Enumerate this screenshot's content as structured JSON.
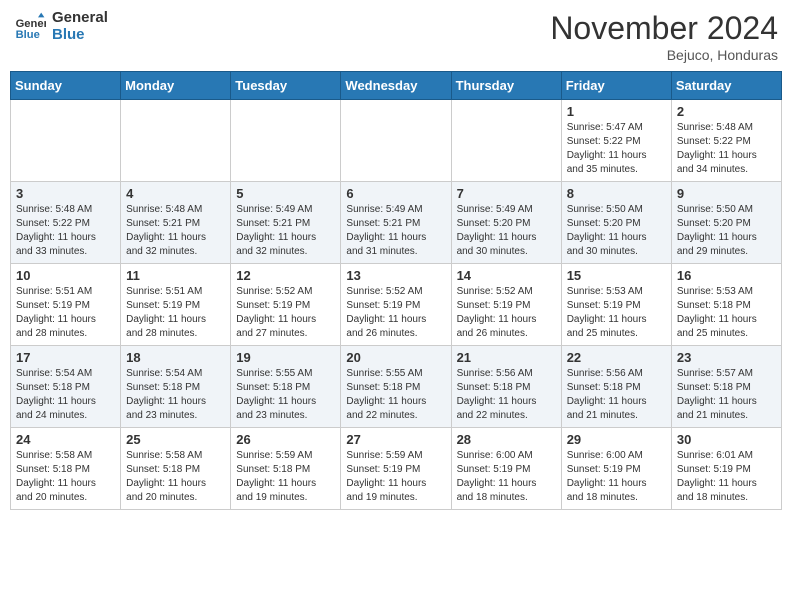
{
  "header": {
    "logo_line1": "General",
    "logo_line2": "Blue",
    "month_title": "November 2024",
    "location": "Bejuco, Honduras"
  },
  "weekdays": [
    "Sunday",
    "Monday",
    "Tuesday",
    "Wednesday",
    "Thursday",
    "Friday",
    "Saturday"
  ],
  "weeks": [
    [
      {
        "day": "",
        "info": ""
      },
      {
        "day": "",
        "info": ""
      },
      {
        "day": "",
        "info": ""
      },
      {
        "day": "",
        "info": ""
      },
      {
        "day": "",
        "info": ""
      },
      {
        "day": "1",
        "info": "Sunrise: 5:47 AM\nSunset: 5:22 PM\nDaylight: 11 hours\nand 35 minutes."
      },
      {
        "day": "2",
        "info": "Sunrise: 5:48 AM\nSunset: 5:22 PM\nDaylight: 11 hours\nand 34 minutes."
      }
    ],
    [
      {
        "day": "3",
        "info": "Sunrise: 5:48 AM\nSunset: 5:22 PM\nDaylight: 11 hours\nand 33 minutes."
      },
      {
        "day": "4",
        "info": "Sunrise: 5:48 AM\nSunset: 5:21 PM\nDaylight: 11 hours\nand 32 minutes."
      },
      {
        "day": "5",
        "info": "Sunrise: 5:49 AM\nSunset: 5:21 PM\nDaylight: 11 hours\nand 32 minutes."
      },
      {
        "day": "6",
        "info": "Sunrise: 5:49 AM\nSunset: 5:21 PM\nDaylight: 11 hours\nand 31 minutes."
      },
      {
        "day": "7",
        "info": "Sunrise: 5:49 AM\nSunset: 5:20 PM\nDaylight: 11 hours\nand 30 minutes."
      },
      {
        "day": "8",
        "info": "Sunrise: 5:50 AM\nSunset: 5:20 PM\nDaylight: 11 hours\nand 30 minutes."
      },
      {
        "day": "9",
        "info": "Sunrise: 5:50 AM\nSunset: 5:20 PM\nDaylight: 11 hours\nand 29 minutes."
      }
    ],
    [
      {
        "day": "10",
        "info": "Sunrise: 5:51 AM\nSunset: 5:19 PM\nDaylight: 11 hours\nand 28 minutes."
      },
      {
        "day": "11",
        "info": "Sunrise: 5:51 AM\nSunset: 5:19 PM\nDaylight: 11 hours\nand 28 minutes."
      },
      {
        "day": "12",
        "info": "Sunrise: 5:52 AM\nSunset: 5:19 PM\nDaylight: 11 hours\nand 27 minutes."
      },
      {
        "day": "13",
        "info": "Sunrise: 5:52 AM\nSunset: 5:19 PM\nDaylight: 11 hours\nand 26 minutes."
      },
      {
        "day": "14",
        "info": "Sunrise: 5:52 AM\nSunset: 5:19 PM\nDaylight: 11 hours\nand 26 minutes."
      },
      {
        "day": "15",
        "info": "Sunrise: 5:53 AM\nSunset: 5:19 PM\nDaylight: 11 hours\nand 25 minutes."
      },
      {
        "day": "16",
        "info": "Sunrise: 5:53 AM\nSunset: 5:18 PM\nDaylight: 11 hours\nand 25 minutes."
      }
    ],
    [
      {
        "day": "17",
        "info": "Sunrise: 5:54 AM\nSunset: 5:18 PM\nDaylight: 11 hours\nand 24 minutes."
      },
      {
        "day": "18",
        "info": "Sunrise: 5:54 AM\nSunset: 5:18 PM\nDaylight: 11 hours\nand 23 minutes."
      },
      {
        "day": "19",
        "info": "Sunrise: 5:55 AM\nSunset: 5:18 PM\nDaylight: 11 hours\nand 23 minutes."
      },
      {
        "day": "20",
        "info": "Sunrise: 5:55 AM\nSunset: 5:18 PM\nDaylight: 11 hours\nand 22 minutes."
      },
      {
        "day": "21",
        "info": "Sunrise: 5:56 AM\nSunset: 5:18 PM\nDaylight: 11 hours\nand 22 minutes."
      },
      {
        "day": "22",
        "info": "Sunrise: 5:56 AM\nSunset: 5:18 PM\nDaylight: 11 hours\nand 21 minutes."
      },
      {
        "day": "23",
        "info": "Sunrise: 5:57 AM\nSunset: 5:18 PM\nDaylight: 11 hours\nand 21 minutes."
      }
    ],
    [
      {
        "day": "24",
        "info": "Sunrise: 5:58 AM\nSunset: 5:18 PM\nDaylight: 11 hours\nand 20 minutes."
      },
      {
        "day": "25",
        "info": "Sunrise: 5:58 AM\nSunset: 5:18 PM\nDaylight: 11 hours\nand 20 minutes."
      },
      {
        "day": "26",
        "info": "Sunrise: 5:59 AM\nSunset: 5:18 PM\nDaylight: 11 hours\nand 19 minutes."
      },
      {
        "day": "27",
        "info": "Sunrise: 5:59 AM\nSunset: 5:19 PM\nDaylight: 11 hours\nand 19 minutes."
      },
      {
        "day": "28",
        "info": "Sunrise: 6:00 AM\nSunset: 5:19 PM\nDaylight: 11 hours\nand 18 minutes."
      },
      {
        "day": "29",
        "info": "Sunrise: 6:00 AM\nSunset: 5:19 PM\nDaylight: 11 hours\nand 18 minutes."
      },
      {
        "day": "30",
        "info": "Sunrise: 6:01 AM\nSunset: 5:19 PM\nDaylight: 11 hours\nand 18 minutes."
      }
    ]
  ]
}
